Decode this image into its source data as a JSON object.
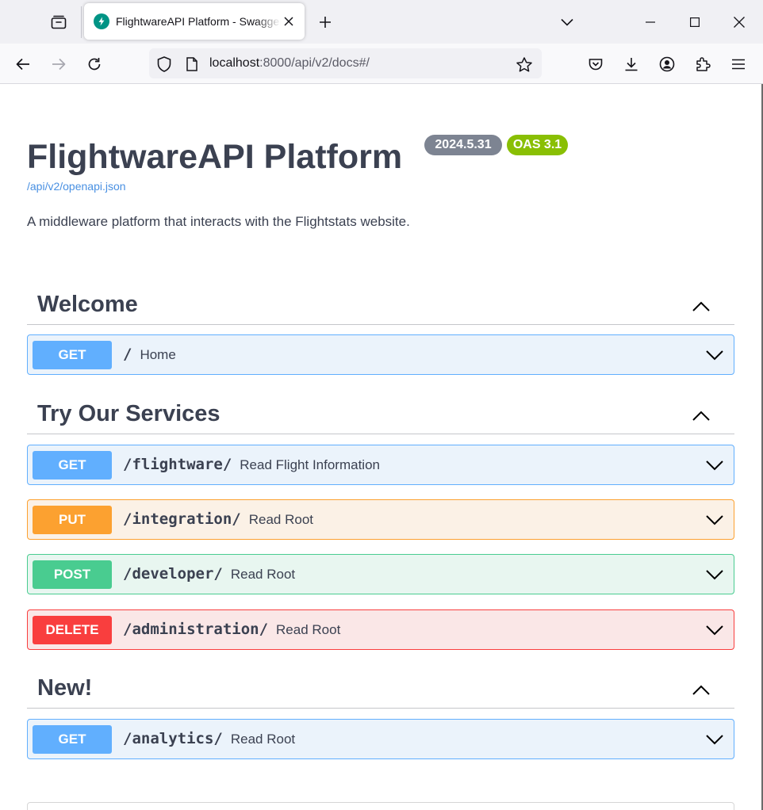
{
  "browser": {
    "tab_title": "FlightwareAPI Platform - Swagger UI",
    "url_host": "localhost",
    "url_rest": ":8000/api/v2/docs#/"
  },
  "info": {
    "title": "FlightwareAPI Platform",
    "version": "2024.5.31",
    "oas": "OAS 3.1",
    "spec_link": "/api/v2/openapi.json",
    "description": "A middleware platform that interacts with the Flightstats website."
  },
  "sections": [
    {
      "name": "Welcome",
      "operations": [
        {
          "method": "GET",
          "path": "/",
          "summary": "Home"
        }
      ]
    },
    {
      "name": "Try Our Services",
      "operations": [
        {
          "method": "GET",
          "path": "/flightware/",
          "summary": "Read Flight Information"
        },
        {
          "method": "PUT",
          "path": "/integration/",
          "summary": "Read Root"
        },
        {
          "method": "POST",
          "path": "/developer/",
          "summary": "Read Root"
        },
        {
          "method": "DELETE",
          "path": "/administration/",
          "summary": "Read Root"
        }
      ]
    },
    {
      "name": "New!",
      "operations": [
        {
          "method": "GET",
          "path": "/analytics/",
          "summary": "Read Root"
        }
      ]
    }
  ],
  "colors": {
    "get": "#61affe",
    "put": "#fca130",
    "post": "#49cc90",
    "delete": "#f93e3e",
    "version_badge": "#7d8492",
    "oas_badge": "#89bf04",
    "link": "#4990e2"
  },
  "icons": {
    "tab_list": "tab-list-icon",
    "favicon": "fastapi-bolt-icon",
    "close": "close-icon",
    "new_tab": "plus-icon",
    "tabs_overflow": "chevron-down-icon",
    "minimize": "minimize-icon",
    "maximize": "maximize-icon",
    "window_close": "window-close-icon",
    "back": "back-arrow-icon",
    "forward": "forward-arrow-icon",
    "reload": "reload-icon",
    "tracking": "shield-icon",
    "page": "page-icon",
    "bookmark": "star-icon",
    "pocket": "pocket-icon",
    "downloads": "download-icon",
    "account": "account-icon",
    "extensions": "extensions-icon",
    "menu": "hamburger-menu-icon",
    "collapse": "chevron-up-icon",
    "expand": "chevron-down-icon"
  }
}
